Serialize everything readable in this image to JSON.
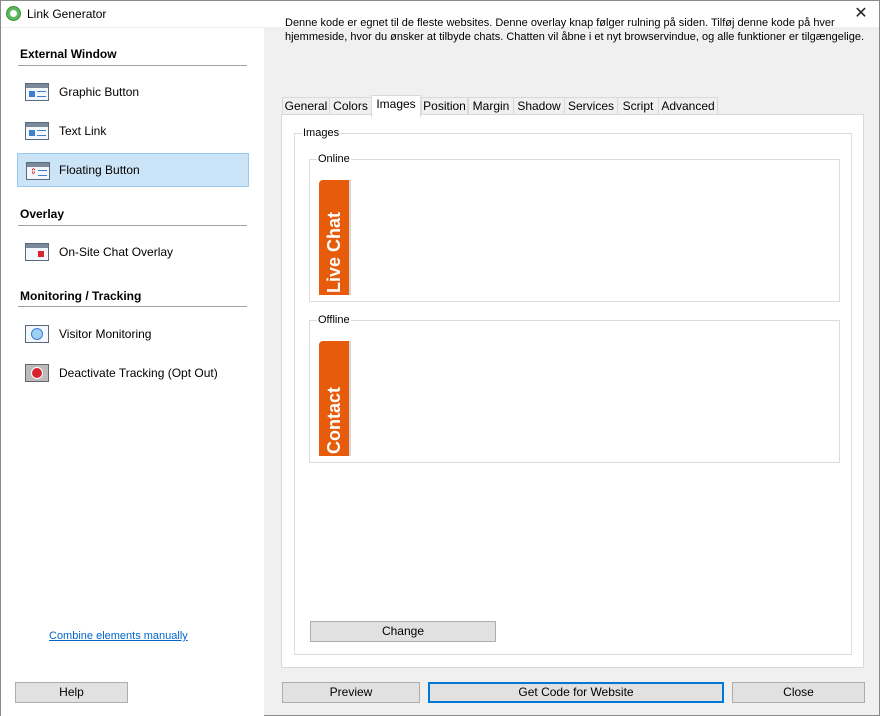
{
  "window": {
    "title": "Link Generator"
  },
  "sidebar": {
    "sections": [
      {
        "title": "External Window"
      },
      {
        "title": "Overlay"
      },
      {
        "title": "Monitoring / Tracking"
      }
    ],
    "items": [
      {
        "label": "Graphic Button",
        "icon": "graphic-button-icon"
      },
      {
        "label": "Text Link",
        "icon": "text-link-icon"
      },
      {
        "label": "Floating Button",
        "icon": "floating-button-icon",
        "selected": true
      },
      {
        "label": "On-Site Chat Overlay",
        "icon": "chat-overlay-icon"
      },
      {
        "label": "Visitor Monitoring",
        "icon": "visitor-monitoring-icon"
      },
      {
        "label": "Deactivate Tracking (Opt Out)",
        "icon": "deactivate-tracking-icon"
      }
    ],
    "combine_link": "Combine elements manually"
  },
  "description": "Denne kode er egnet til de fleste websites. Denne overlay knap følger rulning på siden. Tilføj denne kode på hver hjemmeside, hvor du ønsker at tilbyde chats. Chatten vil åbne i et nyt browservindue, og alle funktioner er tilgængelige.",
  "tabs": [
    {
      "label": "General"
    },
    {
      "label": "Colors"
    },
    {
      "label": "Images",
      "active": true
    },
    {
      "label": "Position"
    },
    {
      "label": "Margin"
    },
    {
      "label": "Shadow"
    },
    {
      "label": "Services"
    },
    {
      "label": "Script"
    },
    {
      "label": "Advanced"
    }
  ],
  "images_panel": {
    "group_title": "Images",
    "online": {
      "label": "Online",
      "preview_text": "Live Chat"
    },
    "offline": {
      "label": "Offline",
      "preview_text": "Contact"
    },
    "change_button": "Change"
  },
  "footer": {
    "help": "Help",
    "preview": "Preview",
    "get_code": "Get Code for Website",
    "close": "Close"
  },
  "colors": {
    "selection_bg": "#cce4f7",
    "accent": "#0078d7",
    "chat_button": "#e65c0a",
    "link": "#0066cc"
  }
}
